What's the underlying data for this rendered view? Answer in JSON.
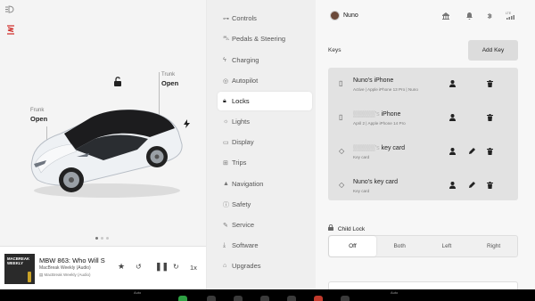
{
  "car": {
    "trunk_title": "Trunk",
    "trunk_state": "Open",
    "frunk_title": "Frunk",
    "frunk_state": "Open",
    "icons": [
      "headlights-icon",
      "suspension-icon",
      "unlock-icon",
      "charge-bolt-icon"
    ]
  },
  "media": {
    "album_text": "MACBREAK WEEKLY",
    "title": "MBW 863: Who Will S",
    "subtitle": "MacBreak Weekly (Audio)",
    "source": "MacBreak Weekly (Audio)",
    "speed": "1x"
  },
  "menu": {
    "items": [
      {
        "label": "Controls",
        "icon": "toggle-icon"
      },
      {
        "label": "Pedals & Steering",
        "icon": "car-icon"
      },
      {
        "label": "Charging",
        "icon": "bolt-icon"
      },
      {
        "label": "Autopilot",
        "icon": "steering-wheel-icon"
      },
      {
        "label": "Locks",
        "icon": "lock-icon"
      },
      {
        "label": "Lights",
        "icon": "sun-icon"
      },
      {
        "label": "Display",
        "icon": "display-icon"
      },
      {
        "label": "Trips",
        "icon": "trips-icon"
      },
      {
        "label": "Navigation",
        "icon": "navigation-icon"
      },
      {
        "label": "Safety",
        "icon": "safety-icon"
      },
      {
        "label": "Service",
        "icon": "wrench-icon"
      },
      {
        "label": "Software",
        "icon": "download-icon"
      },
      {
        "label": "Upgrades",
        "icon": "bag-icon"
      }
    ],
    "active": "Locks"
  },
  "user": {
    "name": "Nuno"
  },
  "top_icons": [
    "home-icon",
    "bell-icon",
    "bluetooth-icon",
    "lte-signal-icon"
  ],
  "keys": {
    "heading": "Keys",
    "add_label": "Add Key",
    "items": [
      {
        "type": "phone",
        "name_visible": "Nuno's iPhone",
        "name_hidden": "",
        "desc": "Active | Apple iPhone 13 Pro | Nuno",
        "actions": [
          "person",
          "trash"
        ]
      },
      {
        "type": "phone",
        "name_visible": "iPhone",
        "name_hidden": "▒▒▒▒▒'s",
        "desc": "April 2 | Apple iPhone 14 Pro",
        "actions": [
          "person",
          "trash"
        ]
      },
      {
        "type": "card",
        "name_visible": "key card",
        "name_hidden": "▒▒▒▒▒'s",
        "desc": "Key card",
        "actions": [
          "person",
          "edit",
          "trash"
        ]
      },
      {
        "type": "card",
        "name_visible": "Nuno's key card",
        "name_hidden": "",
        "desc": "Key card",
        "actions": [
          "person",
          "edit",
          "trash"
        ]
      }
    ]
  },
  "child_lock": {
    "label": "Child Lock",
    "options": [
      "Off",
      "Both",
      "Left",
      "Right"
    ],
    "selected": "Off"
  },
  "bottom": {
    "left_label": "Auto",
    "right_label": "Auto"
  },
  "colors": {
    "accent_red": "#d0312d",
    "active_bg": "#ffffff",
    "car_white": "#f2f4f6"
  }
}
